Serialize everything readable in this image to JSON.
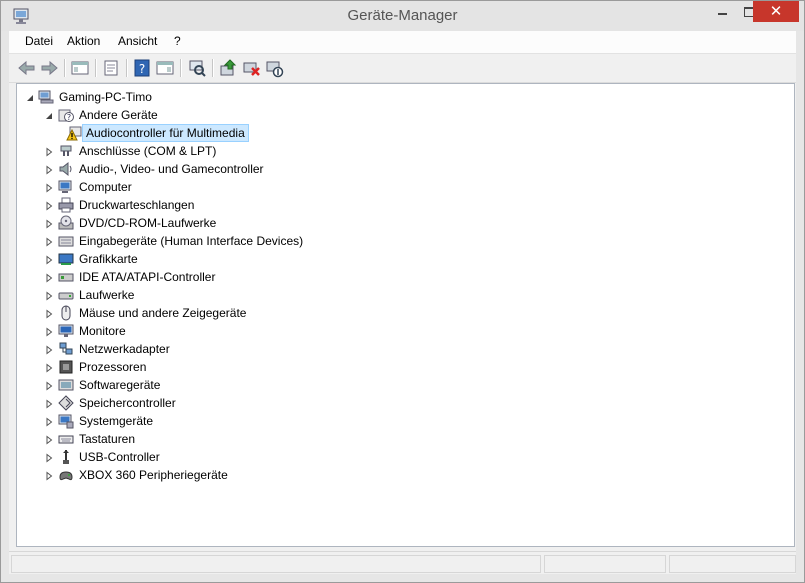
{
  "window": {
    "title": "Geräte-Manager",
    "close_glyph": "✕"
  },
  "menu": [
    {
      "label": "Datei"
    },
    {
      "label": "Aktion"
    },
    {
      "label": "Ansicht"
    },
    {
      "label": "?"
    }
  ],
  "toolbar": [
    {
      "icon": "back-arrow-icon"
    },
    {
      "icon": "forward-arrow-icon"
    },
    {
      "icon": "show-hide-console-tree-icon"
    },
    {
      "icon": "properties-icon"
    },
    {
      "icon": "help-icon"
    },
    {
      "icon": "show-action-pane-icon"
    },
    {
      "icon": "scan-hardware-icon"
    },
    {
      "icon": "update-driver-icon"
    },
    {
      "icon": "uninstall-device-icon"
    },
    {
      "icon": "disable-device-icon"
    }
  ],
  "tree": {
    "root": {
      "label": "Gaming-PC-Timo",
      "icon": "computer-root-icon"
    },
    "other": {
      "label": "Andere Geräte",
      "icon": "unknown-device-icon"
    },
    "selected_child": {
      "label": "Audiocontroller für Multimedia",
      "icon": "warning-device-icon"
    },
    "categories": [
      {
        "label": "Anschlüsse (COM & LPT)",
        "icon": "port-icon"
      },
      {
        "label": "Audio-, Video- und Gamecontroller",
        "icon": "speaker-icon"
      },
      {
        "label": "Computer",
        "icon": "computer-icon"
      },
      {
        "label": "Druckwarteschlangen",
        "icon": "printer-icon"
      },
      {
        "label": "DVD/CD-ROM-Laufwerke",
        "icon": "optical-drive-icon"
      },
      {
        "label": "Eingabegeräte (Human Interface Devices)",
        "icon": "hid-icon"
      },
      {
        "label": "Grafikkarte",
        "icon": "display-adapter-icon"
      },
      {
        "label": "IDE ATA/ATAPI-Controller",
        "icon": "ide-controller-icon"
      },
      {
        "label": "Laufwerke",
        "icon": "disk-drive-icon"
      },
      {
        "label": "Mäuse und andere Zeigegeräte",
        "icon": "mouse-icon"
      },
      {
        "label": "Monitore",
        "icon": "monitor-icon"
      },
      {
        "label": "Netzwerkadapter",
        "icon": "network-adapter-icon"
      },
      {
        "label": "Prozessoren",
        "icon": "processor-icon"
      },
      {
        "label": "Softwaregeräte",
        "icon": "software-device-icon"
      },
      {
        "label": "Speichercontroller",
        "icon": "storage-controller-icon"
      },
      {
        "label": "Systemgeräte",
        "icon": "system-device-icon"
      },
      {
        "label": "Tastaturen",
        "icon": "keyboard-icon"
      },
      {
        "label": "USB-Controller",
        "icon": "usb-icon"
      },
      {
        "label": "XBOX 360 Peripheriegeräte",
        "icon": "gamepad-icon"
      }
    ]
  }
}
